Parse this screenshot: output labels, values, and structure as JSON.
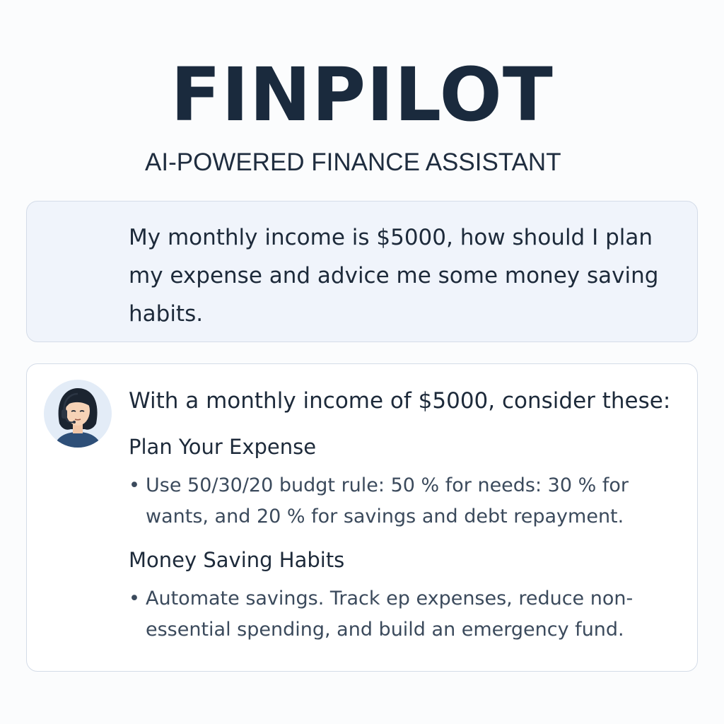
{
  "header": {
    "title": "FINPILOT",
    "subtitle": "AI-POWERED FINANCE ASSISTANT"
  },
  "conversation": {
    "user_message": "My monthly income is $5000, how should I plan my expense and advice me some money saving habits.",
    "assistant": {
      "avatar_icon": "woman-with-headset-avatar",
      "heading": "With a monthly income of $5000, consider these:",
      "sections": [
        {
          "title": "Plan Your Expense",
          "bullet": "•",
          "text": "Use 50/30/20 budgt rule: 50 % for needs:  30 % for wants, and 20 % for savings and debt repayment."
        },
        {
          "title": "Money Saving Habits",
          "bullet": "•",
          "text": "Automate savings. Track ep expenses, reduce non-essential spending, and build an emergency fund."
        }
      ]
    }
  },
  "colors": {
    "title": "#1a2a3d",
    "user_bubble_bg": "#f0f4fb",
    "bubble_border": "#d4dce8",
    "body_text": "#3b4a5c",
    "avatar_bg": "#e3ecf7"
  }
}
